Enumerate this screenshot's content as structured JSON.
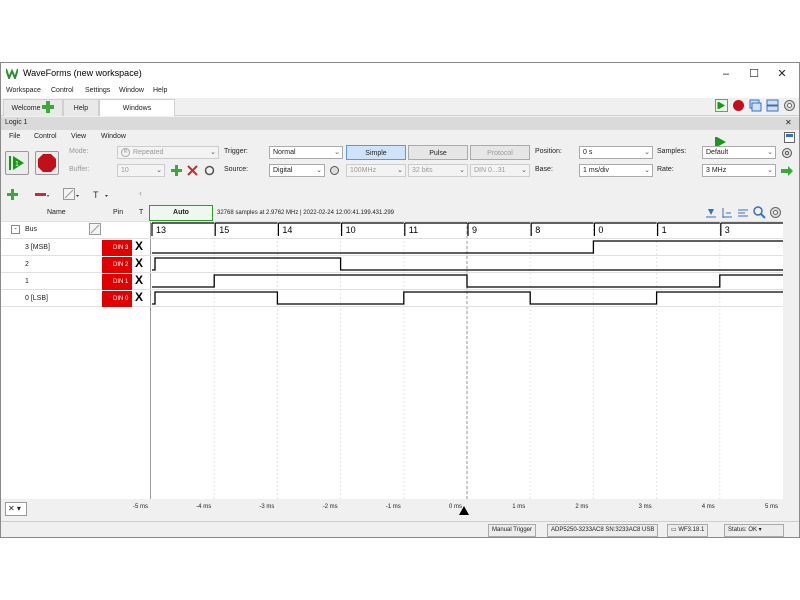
{
  "window": {
    "title": "WaveForms (new workspace)",
    "controls": [
      "–",
      "☐",
      "✕"
    ]
  },
  "menu": [
    "Workspace",
    "Control",
    "Settings",
    "Window",
    "Help"
  ],
  "tabs": {
    "welcome": "Welcome",
    "help": "Help",
    "windows": "Windows"
  },
  "instrument": {
    "title": "Logic 1",
    "close": "✕",
    "menu": [
      "File",
      "Control",
      "View",
      "Window"
    ]
  },
  "controls": {
    "mode_label": "Mode:",
    "mode_value": "Repeated",
    "buffer_label": "Buffer:",
    "buffer_value": "10",
    "trigger_label": "Trigger:",
    "trigger_value": "Normal",
    "source_label": "Source:",
    "source_value": "Digital",
    "modes": [
      "Simple",
      "Pulse",
      "Protocol"
    ],
    "speed_value": "100MHz",
    "bits_value": "32 bits",
    "din_value": "DIN 0...31",
    "position_label": "Position:",
    "position_value": "0 s",
    "base_label": "Base:",
    "base_value": "1 ms/div",
    "samples_label": "Samples:",
    "samples_value": "Default",
    "rate_label": "Rate:",
    "rate_value": "3 MHz"
  },
  "plot": {
    "auto_label": "Auto",
    "info": "32768 samples at 2.9762 MHz | 2022-02-24 12:00:41.199.431.299",
    "col_name": "Name",
    "col_pin": "Pin",
    "col_t": "T",
    "bus_label": "Bus",
    "bus_values": [
      "13",
      "15",
      "14",
      "10",
      "11",
      "9",
      "8",
      "0",
      "1",
      "3"
    ],
    "signals": [
      {
        "name": "3 [MSB]",
        "pin": "DIN 3",
        "bits": [
          0,
          0,
          0,
          0,
          0,
          0,
          0,
          1,
          1,
          1
        ]
      },
      {
        "name": "2",
        "pin": "DIN 2",
        "bits": [
          1,
          1,
          1,
          0,
          0,
          0,
          0,
          0,
          0,
          0
        ]
      },
      {
        "name": "1",
        "pin": "DIN 1",
        "bits": [
          0,
          1,
          1,
          1,
          1,
          0,
          0,
          0,
          0,
          1
        ]
      },
      {
        "name": "0 [LSB]",
        "pin": "DIN 0",
        "bits": [
          1,
          1,
          0,
          0,
          1,
          1,
          0,
          0,
          1,
          1
        ]
      }
    ],
    "signal_color": "#000000",
    "pin_color": "#e00000"
  },
  "time_axis": [
    "-5 ms",
    "-4 ms",
    "-3 ms",
    "-2 ms",
    "-1 ms",
    "0 ms",
    "1 ms",
    "2 ms",
    "3 ms",
    "4 ms",
    "5 ms"
  ],
  "status": {
    "manual_trigger": "Manual Trigger",
    "device": "ADP5250-3233AC8 SN:3233AC8 USB",
    "version": "WF3.18.1",
    "status": "Status: OK"
  }
}
